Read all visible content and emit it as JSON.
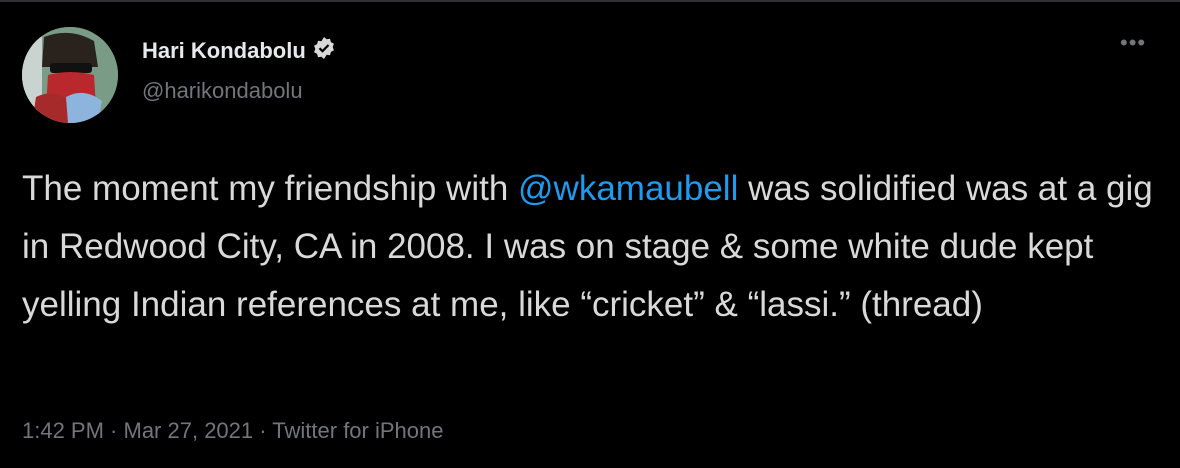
{
  "author": {
    "name": "Hari Kondabolu",
    "handle": "@harikondabolu",
    "verified": true
  },
  "menu_icon": "more-horizontal-icon",
  "tweet": {
    "text_before": "The moment my friendship with ",
    "mention": "@wkamaubell",
    "text_after": " was solidified was at a gig in Redwood City, CA in 2008. I was on stage & some white dude kept yelling Indian references at me, like “cricket” & “lassi.” (thread)"
  },
  "footer": {
    "time": "1:42 PM",
    "sep1": " · ",
    "date": "Mar 27, 2021",
    "sep2": " · ",
    "source": "Twitter for iPhone"
  },
  "colors": {
    "background": "#000000",
    "mention": "#1d9bf0",
    "secondary": "#71767b"
  }
}
